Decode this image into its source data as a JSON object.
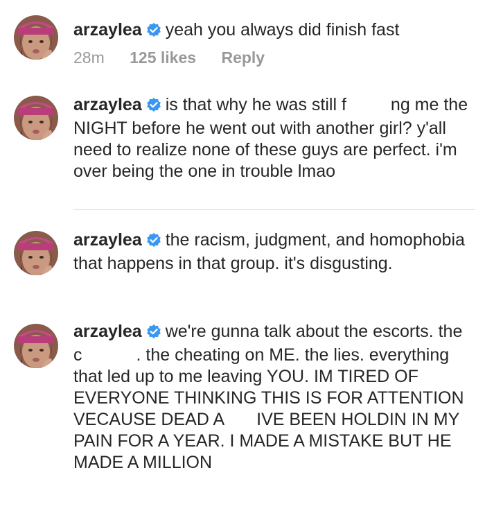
{
  "comments": [
    {
      "username": "arzaylea",
      "text": "yeah you always did finish fast",
      "time": "28m",
      "likes": "125 likes",
      "reply": "Reply"
    },
    {
      "username": "arzaylea",
      "text_a": "is that why he was still f",
      "text_b": "ng me the NIGHT before he went out with another girl? y'all need to realize none of these guys are perfect. i'm over being the one in trouble lmao"
    },
    {
      "username": "arzaylea",
      "text": "the racism, judgment, and homophobia that happens in that group. it's disgusting."
    },
    {
      "username": "arzaylea",
      "text_a": "we're gunna talk about the escorts. the c",
      "text_b": ". the cheating on ME. the lies. everything that led up to me leaving YOU. IM TIRED OF EVERYONE THINKING THIS IS FOR ATTENTION VECAUSE DEAD A",
      "text_c": "IVE BEEN HOLDIN IN MY PAIN FOR A YEAR. I MADE A MISTAKE BUT HE MADE A MILLION"
    }
  ],
  "colors": {
    "verified": "#3897f0",
    "meta": "#999999",
    "divider": "#dbdbdb"
  },
  "icons": {
    "verified": "verified-badge-icon",
    "avatar": "profile-photo"
  }
}
